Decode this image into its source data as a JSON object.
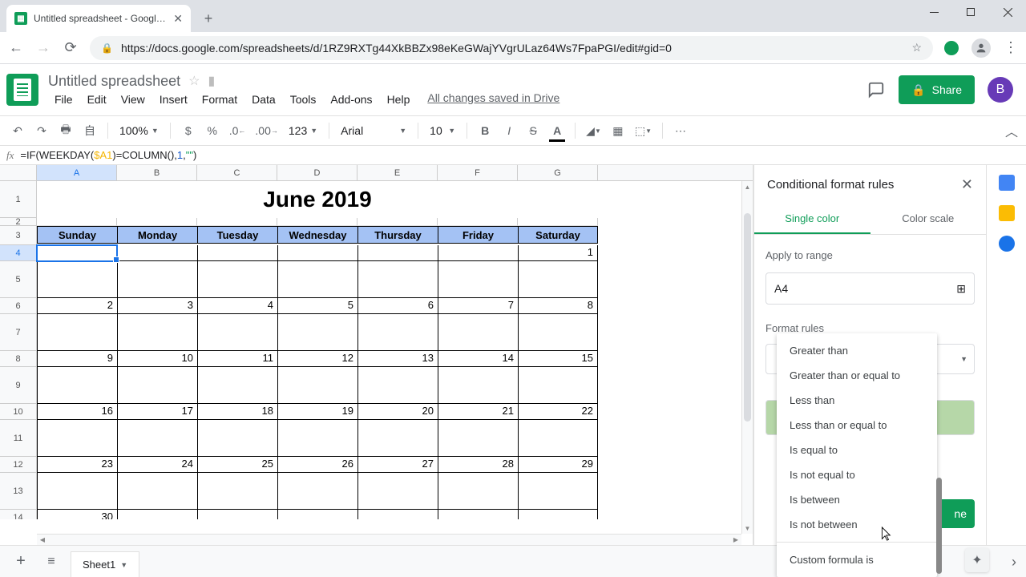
{
  "browser": {
    "tab_title": "Untitled spreadsheet - Google S",
    "url": "https://docs.google.com/spreadsheets/d/1RZ9RXTg44XkBBZx98eKeGWajYVgrULaz64Ws7FpaPGI/edit#gid=0"
  },
  "doc": {
    "title": "Untitled spreadsheet",
    "save_status": "All changes saved in Drive",
    "menus": [
      "File",
      "Edit",
      "View",
      "Insert",
      "Format",
      "Data",
      "Tools",
      "Add-ons",
      "Help"
    ],
    "share_label": "Share",
    "avatar_letter": "B"
  },
  "toolbar": {
    "zoom": "100%",
    "currency": "$",
    "percent": "%",
    "dec_dec": ".0",
    "inc_dec": ".00",
    "more_fmt": "123",
    "font": "Arial",
    "font_size": "10"
  },
  "formula": {
    "prefix": "=IF(WEEKDAY(",
    "ref": "$A1",
    "mid": ")=COLUMN(),",
    "num": "1",
    "comma": ",",
    "str": "\"\"",
    "suffix": ")"
  },
  "sheet": {
    "columns": [
      "A",
      "B",
      "C",
      "D",
      "E",
      "F",
      "G"
    ],
    "title_cell": "June 2019",
    "day_headers": [
      "Sunday",
      "Monday",
      "Tuesday",
      "Wednesday",
      "Thursday",
      "Friday",
      "Saturday"
    ],
    "weeks": [
      [
        "",
        "",
        "",
        "",
        "",
        "",
        "1"
      ],
      [
        "2",
        "3",
        "4",
        "5",
        "6",
        "7",
        "8"
      ],
      [
        "9",
        "10",
        "11",
        "12",
        "13",
        "14",
        "15"
      ],
      [
        "16",
        "17",
        "18",
        "19",
        "20",
        "21",
        "22"
      ],
      [
        "23",
        "24",
        "25",
        "26",
        "27",
        "28",
        "29"
      ],
      [
        "30",
        "",
        "",
        "",
        "",
        "",
        ""
      ]
    ],
    "partial_last": "30",
    "sheet_tab": "Sheet1"
  },
  "cond": {
    "title": "Conditional format rules",
    "tab_single": "Single color",
    "tab_scale": "Color scale",
    "apply_label": "Apply to range",
    "range_value": "A4",
    "format_rules_label": "Format rules",
    "done": "ne",
    "dropdown": [
      "Greater than",
      "Greater than or equal to",
      "Less than",
      "Less than or equal to",
      "Is equal to",
      "Is not equal to",
      "Is between",
      "Is not between"
    ],
    "dropdown_last": "Custom formula is"
  }
}
